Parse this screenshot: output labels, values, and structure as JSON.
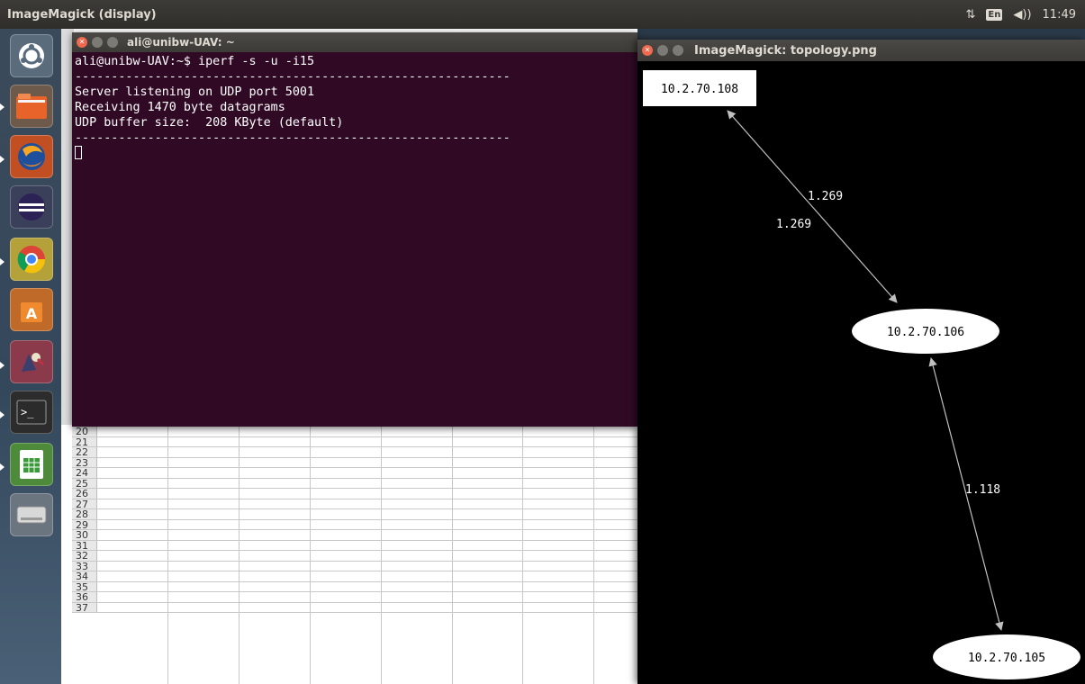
{
  "top_panel": {
    "title": "ImageMagick (display)",
    "keyboard_layout": "En",
    "clock": "11:49"
  },
  "launcher": {
    "items": [
      "ubuntu-dash",
      "files",
      "firefox",
      "eclipse",
      "chrome",
      "software-center",
      "gimp",
      "terminal",
      "libreoffice-calc",
      "disk"
    ]
  },
  "spreadsheet": {
    "row_numbers": [
      "20",
      "21",
      "22",
      "23",
      "24",
      "25",
      "26",
      "27",
      "28",
      "29",
      "30",
      "31",
      "32",
      "33",
      "34",
      "35",
      "36",
      "37"
    ]
  },
  "terminal": {
    "title": "ali@unibw-UAV: ~",
    "lines": [
      "ali@unibw-UAV:~$ iperf -s -u -i15",
      "------------------------------------------------------------",
      "Server listening on UDP port 5001",
      "Receiving 1470 byte datagrams",
      "UDP buffer size:  208 KByte (default)",
      "------------------------------------------------------------"
    ]
  },
  "image_window": {
    "title": "ImageMagick: topology.png",
    "nodes": [
      "10.2.70.108",
      "10.2.70.106",
      "10.2.70.105"
    ],
    "edge_labels": [
      "1.269",
      "1.269",
      "1.118"
    ]
  },
  "colors": {
    "terminal_bg": "#300a24",
    "panel_bg": "#3c3b37",
    "close_button": "#f0684d"
  }
}
